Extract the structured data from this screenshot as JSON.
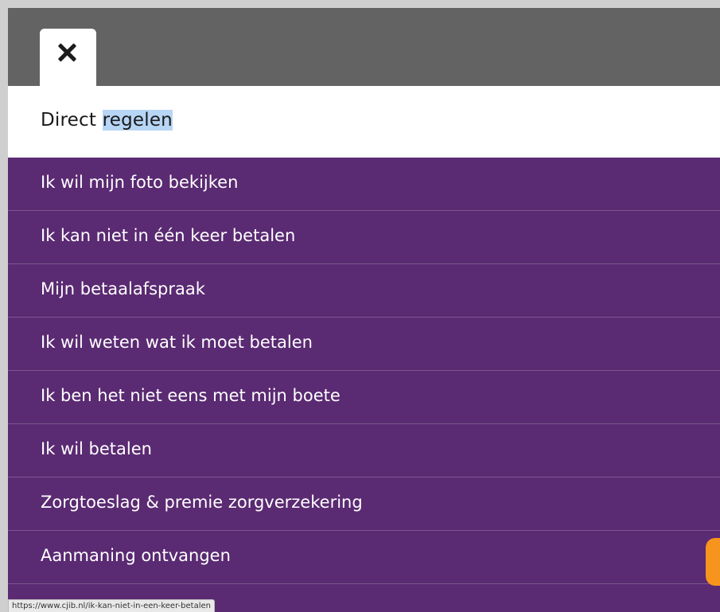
{
  "colors": {
    "menu_background": "#5a2a72",
    "menu_divider": "#7a5890",
    "header_background": "#636363",
    "selection_highlight": "#b7d5f5",
    "chat_accent": "#f7941d"
  },
  "close_tab": {
    "icon": "close-icon"
  },
  "title": {
    "prefix": "Direct ",
    "selected": "regelen"
  },
  "menu": {
    "items": [
      {
        "label": "Ik wil mijn foto bekijken"
      },
      {
        "label": "Ik kan niet in één keer betalen"
      },
      {
        "label": "Mijn betaalafspraak"
      },
      {
        "label": "Ik wil weten wat ik moet betalen"
      },
      {
        "label": "Ik ben het niet eens met mijn boete"
      },
      {
        "label": "Ik wil betalen"
      },
      {
        "label": "Zorgtoeslag & premie zorgverzekering"
      },
      {
        "label": "Aanmaning ontvangen"
      }
    ]
  },
  "status_bar": {
    "url": "https://www.cjib.nl/ik-kan-niet-in-een-keer-betalen"
  }
}
